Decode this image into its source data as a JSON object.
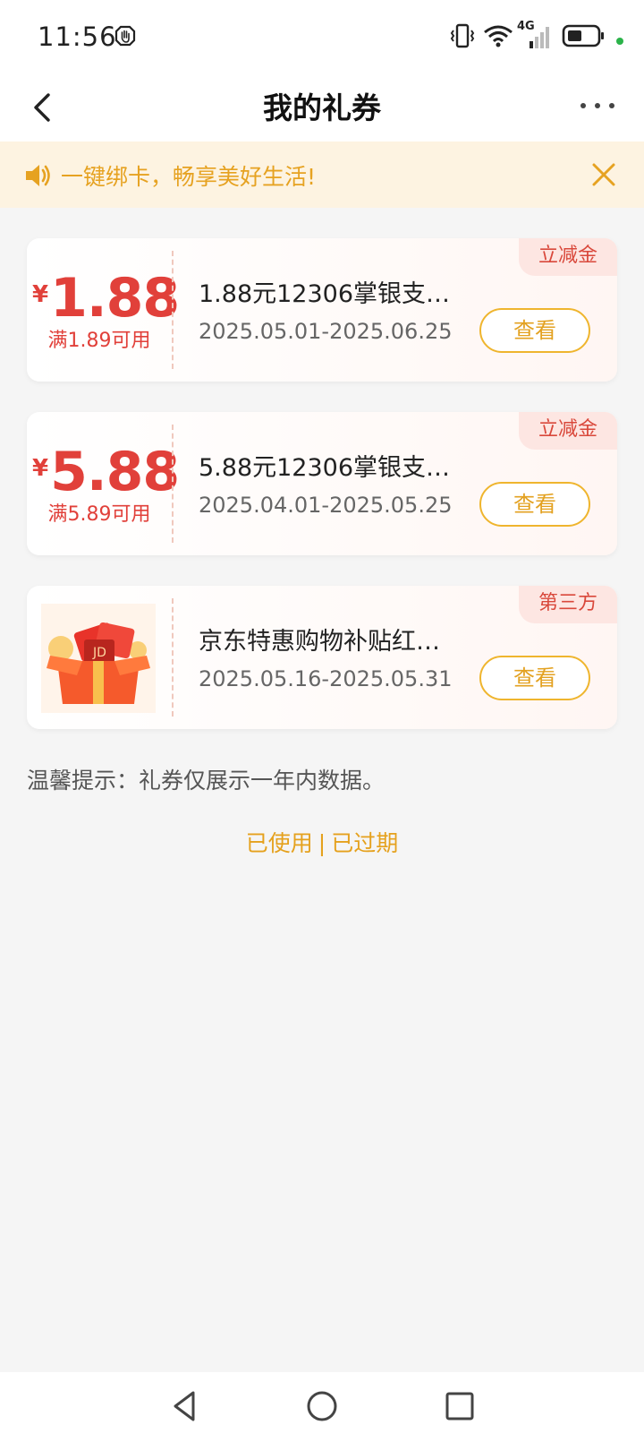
{
  "status_bar": {
    "time": "11:56",
    "network": "4G",
    "accent_online": "#2bb34a"
  },
  "nav": {
    "title": "我的礼券",
    "back_icon": "chevron-left-icon",
    "more_icon": "more-dots-icon"
  },
  "notice": {
    "text": "一键绑卡，畅享美好生活!",
    "icon": "speaker-icon",
    "close_icon": "close-icon",
    "color": "#e6a221",
    "background": "#fdf3e1"
  },
  "coupons": [
    {
      "tag": "立减金",
      "currency": "¥",
      "amount": "1.88",
      "condition": "满1.89可用",
      "title": "1.88元12306掌银支…",
      "date": "2025.05.01-2025.06.25",
      "button": "查看"
    },
    {
      "tag": "立减金",
      "currency": "¥",
      "amount": "5.88",
      "condition": "满5.89可用",
      "title": "5.88元12306掌银支…",
      "date": "2025.04.01-2025.05.25",
      "button": "查看"
    },
    {
      "tag": "第三方",
      "thumb_icon": "gift-box-image",
      "title": "京东特惠购物补贴红…",
      "date": "2025.05.16-2025.05.31",
      "button": "查看"
    }
  ],
  "tip": "温馨提示：礼券仅展示一年内数据。",
  "links": {
    "used": "已使用",
    "separator": "|",
    "expired": "已过期"
  },
  "colors": {
    "amount_red": "#e1403a",
    "accent_gold": "#efb52e"
  }
}
